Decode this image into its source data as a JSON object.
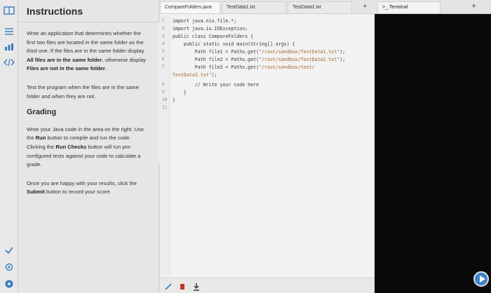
{
  "instructions": {
    "title": "Instructions",
    "p1_a": "Write an application that determines whether the first two files are located in the same folder as the third one. If the files are in the same folder display ",
    "p1_b": "All files are in the same folder",
    "p1_c": ", otherwise display ",
    "p1_d": "Files are not in the same folder",
    "p1_e": ".",
    "p2": "Test the program when the files are in the same folder and when they are not.",
    "grading_title": "Grading",
    "g1_a": "Write your Java code in the area on the right. Use the ",
    "g1_b": "Run",
    "g1_c": " button to compile and run the code. Clicking the ",
    "g1_d": "Run Checks",
    "g1_e": " button will run pre-configured tests against your code to calculate a grade.",
    "g2_a": "Once you are happy with your results, click the ",
    "g2_b": "Submit",
    "g2_c": " button to record your score."
  },
  "editor": {
    "tabs": [
      "CompareFolders.java",
      "TestData1.txt",
      "TestData2.txt"
    ],
    "plus": "+",
    "line_numbers": [
      "1",
      "2",
      "3",
      "4",
      "5",
      "6",
      "7",
      "",
      "8",
      "9",
      "10",
      "11"
    ],
    "code": {
      "l1": "import java.nio.file.*;",
      "l2": "import java.io.IOException;",
      "l3": "public class CompareFolders {",
      "l4": "    public static void main(String[] args) {",
      "l5_a": "        Path file1 = Paths.get(",
      "l5_b": "\"/root/sandbox/TestData1.txt\"",
      "l5_c": ");",
      "l6_a": "        Path file2 = Paths.get(",
      "l6_b": "\"/root/sandbox/TestData2.txt\"",
      "l6_c": ");",
      "l7_a": "        Path file3 = Paths.get(",
      "l7_b": "\"/root/sandbox/test/",
      "l7w_a": "TestData3.txt\"",
      "l7w_b": ");",
      "l8": "        // Write your code here",
      "l9": "    }",
      "l10": "}"
    }
  },
  "terminal": {
    "tab_label": "Terminal",
    "plus": "+"
  },
  "colors": {
    "accent": "#3a7bbf",
    "terminal_bg": "#0a0a0a"
  }
}
